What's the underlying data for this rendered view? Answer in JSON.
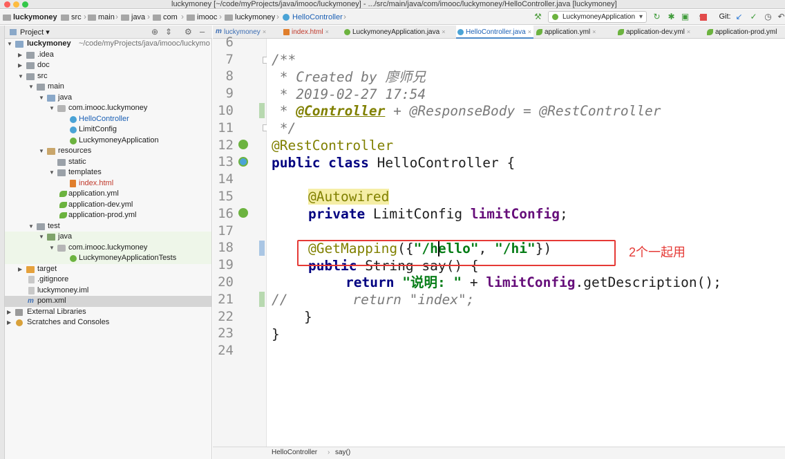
{
  "window": {
    "title": "luckymoney [~/code/myProjects/java/imooc/luckymoney] - .../src/main/java/com/imooc/luckymoney/HelloController.java [luckymoney]"
  },
  "navbar": {
    "breadcrumbs": [
      "luckymoney",
      "src",
      "main",
      "java",
      "com",
      "imooc",
      "luckymoney",
      "HelloController"
    ],
    "run_config": "LuckymoneyApplication",
    "git_label": "Git:"
  },
  "project": {
    "panel_label": "Project",
    "tree": [
      {
        "label": "luckymoney",
        "extra": "~/code/myProjects/java/imooc/luckymo"
      },
      {
        "label": ".idea"
      },
      {
        "label": "doc"
      },
      {
        "label": "src"
      },
      {
        "label": "main"
      },
      {
        "label": "java"
      },
      {
        "label": "com.imooc.luckymoney"
      },
      {
        "label": "HelloController"
      },
      {
        "label": "LimitConfig"
      },
      {
        "label": "LuckymoneyApplication"
      },
      {
        "label": "resources"
      },
      {
        "label": "static"
      },
      {
        "label": "templates"
      },
      {
        "label": "index.html"
      },
      {
        "label": "application.yml"
      },
      {
        "label": "application-dev.yml"
      },
      {
        "label": "application-prod.yml"
      },
      {
        "label": "test"
      },
      {
        "label": "java"
      },
      {
        "label": "com.imooc.luckymoney"
      },
      {
        "label": "LuckymoneyApplicationTests"
      },
      {
        "label": "target"
      },
      {
        "label": ".gitignore"
      },
      {
        "label": "luckymoney.iml"
      },
      {
        "label": "pom.xml"
      },
      {
        "label": "External Libraries"
      },
      {
        "label": "Scratches and Consoles"
      }
    ]
  },
  "tabs": [
    {
      "label": "luckymoney"
    },
    {
      "label": "index.html"
    },
    {
      "label": "LuckymoneyApplication.java"
    },
    {
      "label": "HelloController.java"
    },
    {
      "label": "application.yml"
    },
    {
      "label": "application-dev.yml"
    },
    {
      "label": "application-prod.yml"
    }
  ],
  "editor": {
    "line_numbers": [
      "6",
      "7",
      "8",
      "9",
      "10",
      "11",
      "12",
      "13",
      "14",
      "15",
      "16",
      "17",
      "18",
      "19",
      "20",
      "21",
      "22",
      "23",
      "24"
    ],
    "lines": {
      "l7": "/**",
      "l8": " * Created by 廖师兄",
      "l9": " * 2019-02-27 17:54",
      "l10a": " * ",
      "l10b": "@Controller",
      "l10c": " + @ResponseBody = @RestController",
      "l11": " */",
      "l12": "@RestController",
      "l13a": "public class",
      "l13b": " HelloController {",
      "l15": "@Autowired",
      "l16a": "private",
      "l16b": " LimitConfig ",
      "l16c": "limitConfig",
      "l16d": ";",
      "l18a": "@GetMapping",
      "l18b": "({",
      "l18c": "\"/hello\"",
      "l18d": ", ",
      "l18e": "\"/hi\"",
      "l18f": "})",
      "l19a": "public",
      "l19b": " String say() {",
      "l20a": "return",
      "l20b": " ",
      "l20c": "\"说明: \"",
      "l20d": " + ",
      "l20e": "limitConfig",
      "l20f": ".getDescription();",
      "l21a": "//",
      "l21b": "        return \"index\";",
      "l22": "    }",
      "l23": "}"
    },
    "annotation_note": "2个一起用"
  },
  "statusbar": {
    "crumbs": [
      "HelloController",
      "say()"
    ]
  },
  "colors": {
    "highlight_box": "#e53935",
    "note": "#e53935",
    "string": "#067d17",
    "keyword": "#000080",
    "annotation": "#808000",
    "field": "#660e7a"
  }
}
